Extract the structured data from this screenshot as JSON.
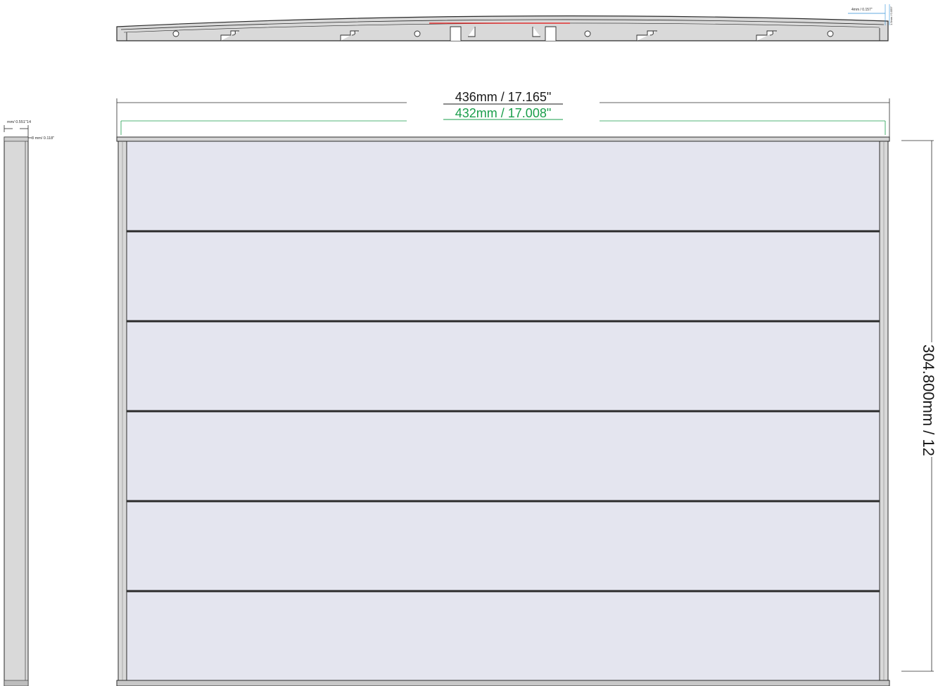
{
  "dimensions": {
    "outer_width": "436mm / 17.165\"",
    "inner_width": "432mm / 17.008\"",
    "height": "304.800mm / 12",
    "side_top": "mm/ 0.551\"14",
    "side_inner": "3 mm/ 0.118\"",
    "top_right_width": "4mm / 0.157\"",
    "top_right_depth": "1.5mm / 0.059\""
  },
  "panel": {
    "slat_count": 6
  },
  "colors": {
    "outline": "#2b2b2b",
    "frame_fill": "#d9d9d9",
    "slat_fill": "#e4e5ef",
    "inner_dimension": "#1a9e4b",
    "accent_red": "#e03030",
    "accent_blue": "#2f8fd8"
  }
}
